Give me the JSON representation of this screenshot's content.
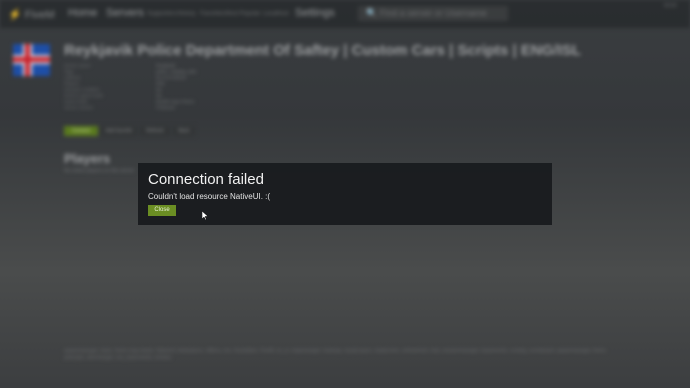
{
  "topbar": {
    "logo": "⚡ FiveM",
    "nav": [
      "Home",
      "Servers"
    ],
    "nav_small": [
      "Supporters",
      "History",
      "Favorites",
      "Most Popular",
      "Localhost"
    ],
    "settings": "Settings",
    "search_placeholder": "🔍 Find a server or Username",
    "clock": "00:00"
  },
  "server": {
    "title": "Reykjavik Police Department Of Saftey | Custom Cars | Scripts | ENG/ISL",
    "info": [
      {
        "key": "Server owner",
        "value": "Reykjavik"
      },
      {
        "key": "Tags",
        "value": "police, roleplay, jobs"
      },
      {
        "key": "Address",
        "value": "81.0.0.0:30120"
      },
      {
        "key": "Players",
        "value": "0/32"
      },
      {
        "key": "Onesync enabled",
        "value": "No"
      },
      {
        "key": "Enforce game build",
        "value": "No"
      },
      {
        "key": "Game build",
        "value": "b2189 Cayo Perico"
      },
      {
        "key": "Server version",
        "value": "FXServer"
      }
    ],
    "buttons": [
      "Connect",
      "Add favorite",
      "Refresh",
      "Back"
    ],
    "players_heading": "Players",
    "players_sub": "No online players on this server.",
    "resources": "spawnmanager, basic, fivem-map-skater, NativeUI, Ambulance, vMenu, esx, foundation, FiveM, es_ui, mapmanager, hardcap, mysql-async, loadscreen, vehiclemod, chat, sessionmanager, baseevents, rconlog, scoreboard, spawnmanager, fivem, policejob, skinchanger, esx_basicneeds, emotes."
  },
  "dialog": {
    "title": "Connection failed",
    "message": "Couldn't load resource NativeUI. :(",
    "close_label": "Close"
  }
}
